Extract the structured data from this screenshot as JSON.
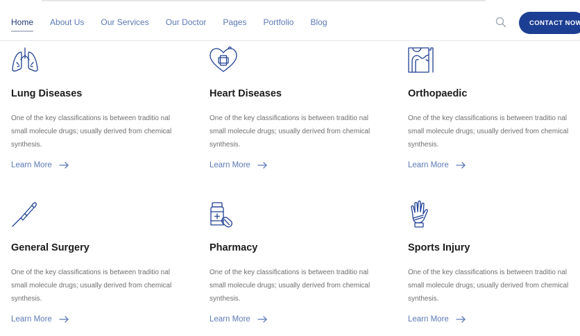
{
  "nav": {
    "items": [
      "Home",
      "About Us",
      "Our Services",
      "Our Doctor",
      "Pages",
      "Portfolio",
      "Blog"
    ],
    "active": "Home",
    "contact_label": "CONTACT NOW",
    "search_icon": "search-icon"
  },
  "services": [
    {
      "title": "Lung Diseases",
      "icon": "lungs-icon",
      "desc": "One of the key classifications is between traditio nal small molecule drugs; usually derived from chemical synthesis.",
      "link": "Learn More"
    },
    {
      "title": "Heart Diseases",
      "icon": "heart-plus-icon",
      "desc": "One of the key classifications is between traditio nal small molecule drugs; usually derived from chemical synthesis.",
      "link": "Learn More"
    },
    {
      "title": "Orthopaedic",
      "icon": "bone-joint-icon",
      "desc": "One of the key classifications is between traditio nal small molecule drugs; usually derived from chemical synthesis.",
      "link": "Learn More"
    },
    {
      "title": "General Surgery",
      "icon": "scalpel-icon",
      "desc": "One of the key classifications is between traditio nal small molecule drugs; usually derived from chemical synthesis.",
      "link": "Learn More"
    },
    {
      "title": "Pharmacy",
      "icon": "medicine-bottle-icon",
      "desc": "One of the key classifications is between traditio nal small molecule drugs; usually derived from chemical synthesis.",
      "link": "Learn More"
    },
    {
      "title": "Sports Injury",
      "icon": "bandaged-hand-icon",
      "desc": "One of the key classifications is between traditio nal small molecule drugs; usually derived from chemical synthesis.",
      "link": "Learn More"
    }
  ],
  "colors": {
    "accent": "#1d3f93",
    "nav_text": "#5b79b4",
    "title": "#1c1c1c",
    "body": "#6e6e6e"
  }
}
